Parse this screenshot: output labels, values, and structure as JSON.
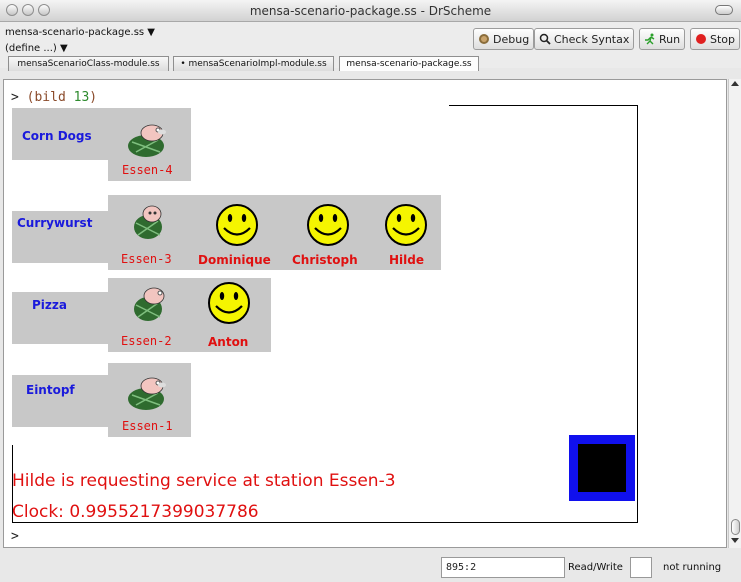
{
  "window": {
    "title": "mensa-scenario-package.ss - DrScheme"
  },
  "toolbar": {
    "file_menu": "mensa-scenario-package.ss ▼",
    "define_menu": "(define ...) ▼",
    "debug_label": "Debug",
    "check_syntax_label": "Check Syntax",
    "run_label": "Run",
    "stop_label": "Stop"
  },
  "tabs": [
    {
      "label": "mensaScenarioClass-module.ss"
    },
    {
      "label": "• mensaScenarioImpl-module.ss"
    },
    {
      "label": "mensa-scenario-package.ss"
    }
  ],
  "repl": {
    "prompt_symbol": ">",
    "command_open": "(bild ",
    "command_num": "13",
    "command_close": ")",
    "rows": [
      {
        "food": "Corn Dogs",
        "station": "Essen-4",
        "people": []
      },
      {
        "food": "Currywurst",
        "station": "Essen-3",
        "people": [
          "Dominique",
          "Christoph",
          "Hilde"
        ]
      },
      {
        "food": "Pizza",
        "station": "Essen-2",
        "people": [
          "Anton"
        ]
      },
      {
        "food": "Eintopf",
        "station": "Essen-1",
        "people": []
      }
    ],
    "message": "Hilde is requesting service at station Essen-3",
    "clock": "Clock: 0.9955217399037786",
    "next_prompt": ">"
  },
  "status": {
    "position": "895:2",
    "mode": "Read/Write",
    "run_state": "not running"
  },
  "colors": {
    "food_label": "#1a1adc",
    "red_text": "#e01010",
    "panel_gray": "#c8c8c8",
    "station_box": "#1010ee"
  }
}
